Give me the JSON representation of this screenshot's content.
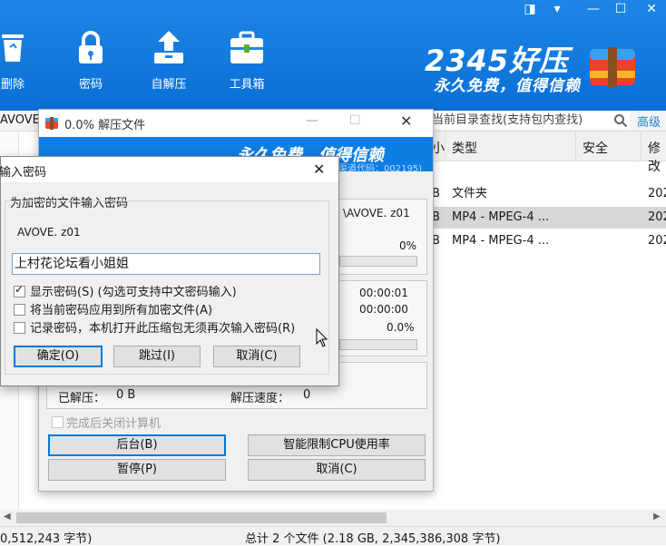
{
  "app": {
    "toolbar": [
      {
        "label": "删除",
        "icon": "recycle-bin-icon"
      },
      {
        "label": "密码",
        "icon": "lock-icon"
      },
      {
        "label": "自解压",
        "icon": "self-extract-icon"
      },
      {
        "label": "工具箱",
        "icon": "toolbox-icon"
      }
    ],
    "logo_text": "2345好压",
    "logo_sub": "永久免费，值得信赖",
    "window_controls": [
      "◨",
      "▾",
      "—",
      "☐",
      "✕"
    ],
    "path_fragment": "AVOVE",
    "search_placeholder": "当前目录查找(支持包内查找)",
    "advanced_label": "高级"
  },
  "file_list": {
    "columns": [
      "小",
      "类型",
      "安全",
      "修改"
    ],
    "rows": [
      {
        "size": "B",
        "type": "文件夹",
        "modified": "202"
      },
      {
        "size": "B",
        "type": "MP4 - MPEG-4 ...",
        "modified": "202"
      },
      {
        "size": "B",
        "type": "MP4 - MPEG-4 ...",
        "modified": "202"
      }
    ]
  },
  "status": {
    "left": "0,512,243 字节)",
    "right": "总计 2 个文件 (2.18 GB, 2,345,386,308 字节)"
  },
  "extract_window": {
    "title": "0.0% 解压文件",
    "banner": "永久免费，值得信赖",
    "banner_code": "渠道代码：002195)",
    "file_name": "\\AVOVE. z01",
    "file_percent": "0%",
    "elapsed": "00:00:01",
    "remaining": "00:00:00",
    "total_percent": "0.0%",
    "extracted_label": "已解压：",
    "extracted_value": "0 B",
    "speed_label": "解压速度：",
    "speed_value": "0",
    "shutdown_label": "完成后关闭计算机",
    "background_button": "后台(B)",
    "cpu_limit_button": "智能限制CPU使用率",
    "pause_button": "暂停(P)",
    "cancel_button": "取消(C)",
    "progress": 0
  },
  "password_dialog": {
    "title": "输入密码",
    "group_label": "为加密的文件输入密码",
    "file_name": "AVOVE. z01",
    "password_value": "上村花论坛看小姐姐",
    "options": [
      {
        "label": "显示密码(S) (勾选可支持中文密码输入)",
        "checked": true
      },
      {
        "label": "将当前密码应用到所有加密文件(A)",
        "checked": false
      },
      {
        "label": "记录密码，本机打开此压缩包无须再次输入密码(R)",
        "checked": false
      }
    ],
    "ok_button": "确定(O)",
    "skip_button": "跳过(I)",
    "cancel_button": "取消(C)"
  }
}
